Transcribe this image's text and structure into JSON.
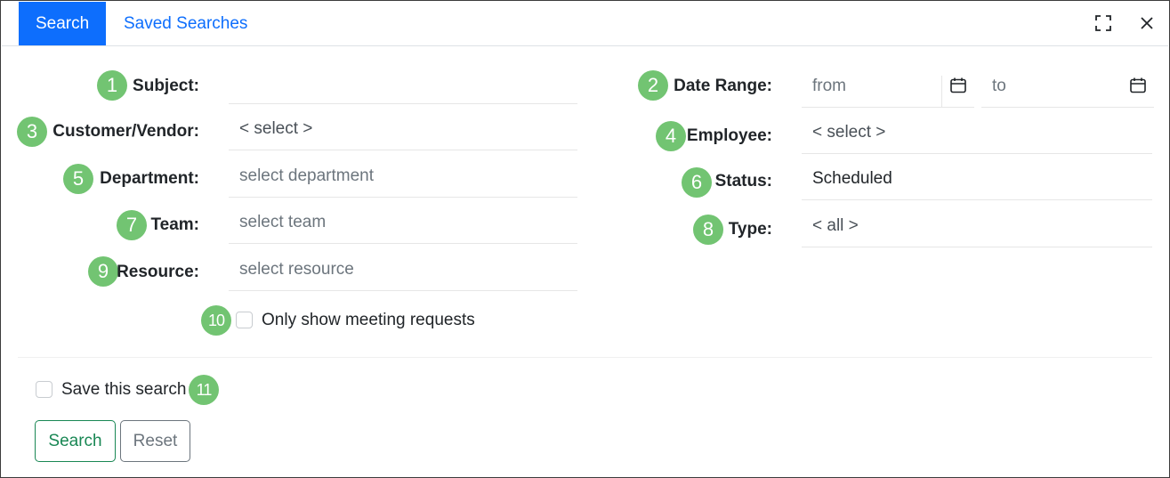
{
  "tabs": {
    "search": "Search",
    "saved": "Saved Searches"
  },
  "badges": [
    "1",
    "2",
    "3",
    "4",
    "5",
    "6",
    "7",
    "8",
    "9",
    "10",
    "11"
  ],
  "form": {
    "subject": {
      "label": "Subject:",
      "value": ""
    },
    "customer_vendor": {
      "label": "Customer/Vendor:",
      "value": "< select >"
    },
    "department": {
      "label": "Department:",
      "placeholder": "select department"
    },
    "team": {
      "label": "Team:",
      "placeholder": "select team"
    },
    "resource": {
      "label": "Resource:",
      "placeholder": "select resource"
    },
    "date_range": {
      "label": "Date Range:",
      "from_placeholder": "from",
      "to_placeholder": "to"
    },
    "employee": {
      "label": "Employee:",
      "value": "< select >"
    },
    "status": {
      "label": "Status:",
      "value": "Scheduled"
    },
    "type": {
      "label": "Type:",
      "value": "< all >"
    },
    "meeting_requests": {
      "label": "Only show meeting requests",
      "checked": false
    }
  },
  "footer": {
    "save_search": {
      "label": "Save this search",
      "checked": false
    },
    "search_button": "Search",
    "reset_button": "Reset"
  },
  "colors": {
    "primary": "#0d6efd",
    "badge": "#72c472",
    "success": "#198754",
    "secondary": "#6c757d"
  }
}
